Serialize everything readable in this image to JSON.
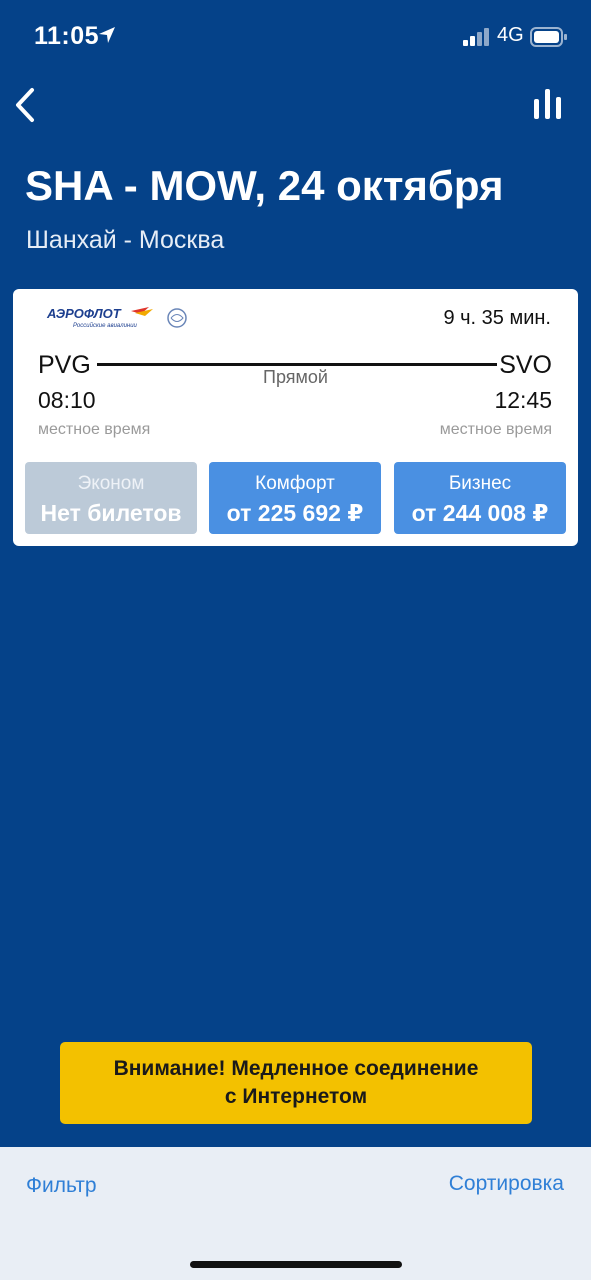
{
  "status_bar": {
    "time": "11:05",
    "network": "4G"
  },
  "header": {
    "title": "SHA - MOW, 24 октября",
    "subtitle": "Шанхай - Москва"
  },
  "flight": {
    "airline": "Аэрофлот",
    "duration": "9 ч. 35 мин.",
    "from_code": "PVG",
    "to_code": "SVO",
    "route_type": "Прямой",
    "departure_time": "08:10",
    "arrival_time": "12:45",
    "departure_tz": "местное время",
    "arrival_tz": "местное время",
    "fares": [
      {
        "name": "Эконом",
        "price": "Нет билетов",
        "available": false
      },
      {
        "name": "Комфорт",
        "price": "от 225 692 ₽",
        "available": true
      },
      {
        "name": "Бизнес",
        "price": "от 244 008 ₽",
        "available": true
      }
    ]
  },
  "warning": {
    "line1": "Внимание! Медленное соединение",
    "line2": "с Интернетом"
  },
  "bottom_bar": {
    "filter_label": "Фильтр",
    "sort_label": "Сортировка"
  },
  "colors": {
    "background": "#054289",
    "card": "#ffffff",
    "fare_active": "#4a90e2",
    "fare_disabled": "#bccad8",
    "warning": "#f3c100",
    "link": "#2f7fd6"
  },
  "icons": [
    "location-arrow-icon",
    "cellular-signal-icon",
    "battery-icon",
    "back-chevron-icon",
    "bar-chart-icon",
    "aeroflot-logo",
    "skyteam-logo"
  ]
}
